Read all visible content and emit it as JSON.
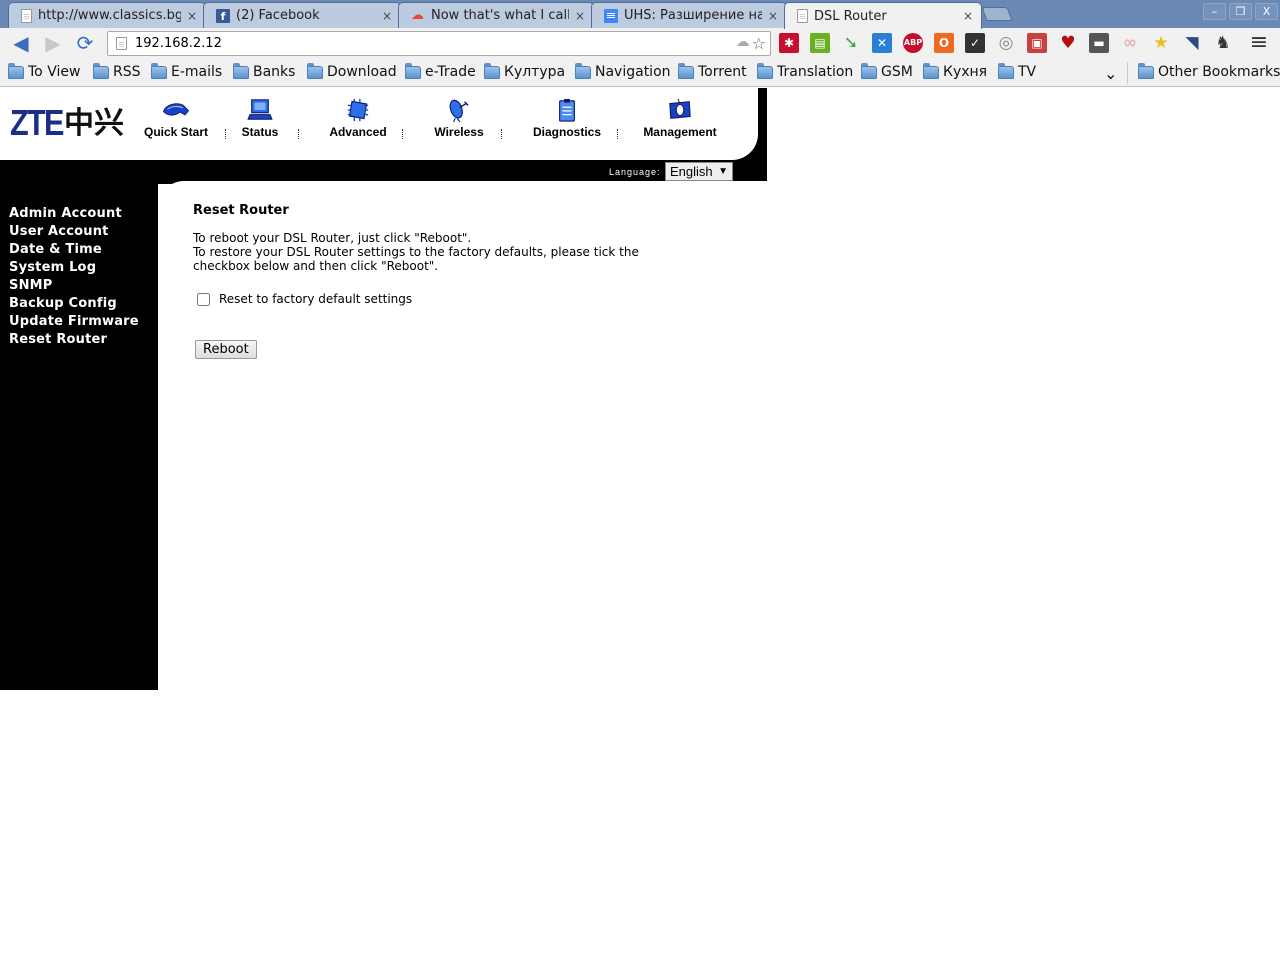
{
  "browser": {
    "tabs": [
      {
        "title": "http://www.classics.bg/",
        "icon": "page-icon",
        "active": false
      },
      {
        "title": "(2) Facebook",
        "icon": "facebook-icon",
        "active": false
      },
      {
        "title": "Now that's what I call a",
        "icon": "cloud-icon",
        "active": false
      },
      {
        "title": "UHS: Разширение на м",
        "icon": "docs-icon",
        "active": false
      },
      {
        "title": "DSL Router",
        "icon": "page-icon",
        "active": true
      }
    ],
    "tab_close_glyph": "×",
    "window_controls": {
      "minimize": "–",
      "restore": "❐",
      "close": "X"
    },
    "url": "192.168.2.12",
    "extensions": [
      {
        "name": "lastpass-icon",
        "glyph": "✱",
        "color": "#c8102e"
      },
      {
        "name": "print-icon",
        "glyph": "▤",
        "color": "#6ab023"
      },
      {
        "name": "redirect-arrow-icon",
        "glyph": "➘",
        "color": "#3aa63a"
      },
      {
        "name": "xmarks-icon",
        "glyph": "✕",
        "color": "#2a7fd4"
      },
      {
        "name": "adblock-plus-icon",
        "glyph": "ABP",
        "color": "#c70d2c"
      },
      {
        "name": "opera-o-icon",
        "glyph": "O",
        "color": "#f26722"
      },
      {
        "name": "checkmark-task-icon",
        "glyph": "✓",
        "color": "#333333"
      },
      {
        "name": "film-reel-icon",
        "glyph": "◎",
        "color": "#888888"
      },
      {
        "name": "save-disk-icon",
        "glyph": "▣",
        "color": "#c84040"
      },
      {
        "name": "heartbleed-icon",
        "glyph": "♥",
        "color": "#b01010"
      },
      {
        "name": "folder-dark-icon",
        "glyph": "▬",
        "color": "#555555"
      },
      {
        "name": "rings-icon",
        "glyph": "∞",
        "color": "#e8b4b4"
      },
      {
        "name": "star-check-icon",
        "glyph": "★",
        "color": "#e8c020"
      },
      {
        "name": "rss-feed-icon",
        "glyph": "◥",
        "color": "#2b4a8a"
      },
      {
        "name": "evernote-icon",
        "glyph": "♞",
        "color": "#333333"
      }
    ],
    "menu_glyph": "≡",
    "bookmarks": [
      "To View",
      "RSS",
      "E-mails",
      "Banks",
      "Download",
      "e-Trade",
      "Култура",
      "Navigation",
      "Torrent",
      "Translation",
      "GSM",
      "Кухня",
      "TV"
    ],
    "bookmarks_overflow_glyph": "⌄",
    "other_bookmarks": "Other Bookmarks"
  },
  "router": {
    "logo": {
      "latin": "ZTE",
      "chinese": "中兴"
    },
    "nav": [
      {
        "label": "Quick Start",
        "icon": "quick-start-icon"
      },
      {
        "label": "Status",
        "icon": "status-laptop-icon"
      },
      {
        "label": "Advanced",
        "icon": "advanced-chip-icon"
      },
      {
        "label": "Wireless",
        "icon": "wireless-antenna-icon"
      },
      {
        "label": "Diagnostics",
        "icon": "diagnostics-clipboard-icon"
      },
      {
        "label": "Management",
        "icon": "management-mouse-icon"
      }
    ],
    "language_label": "Language:",
    "language_value": "English",
    "sidebar": [
      "Admin Account",
      "User Account",
      "Date & Time",
      "System Log",
      "SNMP",
      "Backup Config",
      "Update Firmware",
      "Reset Router"
    ],
    "content": {
      "title": "Reset Router",
      "line1": "To reboot your DSL Router, just click \"Reboot\".",
      "line2": "To restore your DSL Router settings to the factory defaults, please tick the checkbox below and then click \"Reboot\".",
      "checkbox_label": "Reset to factory default settings",
      "checkbox_checked": false,
      "button_label": "Reboot"
    }
  }
}
